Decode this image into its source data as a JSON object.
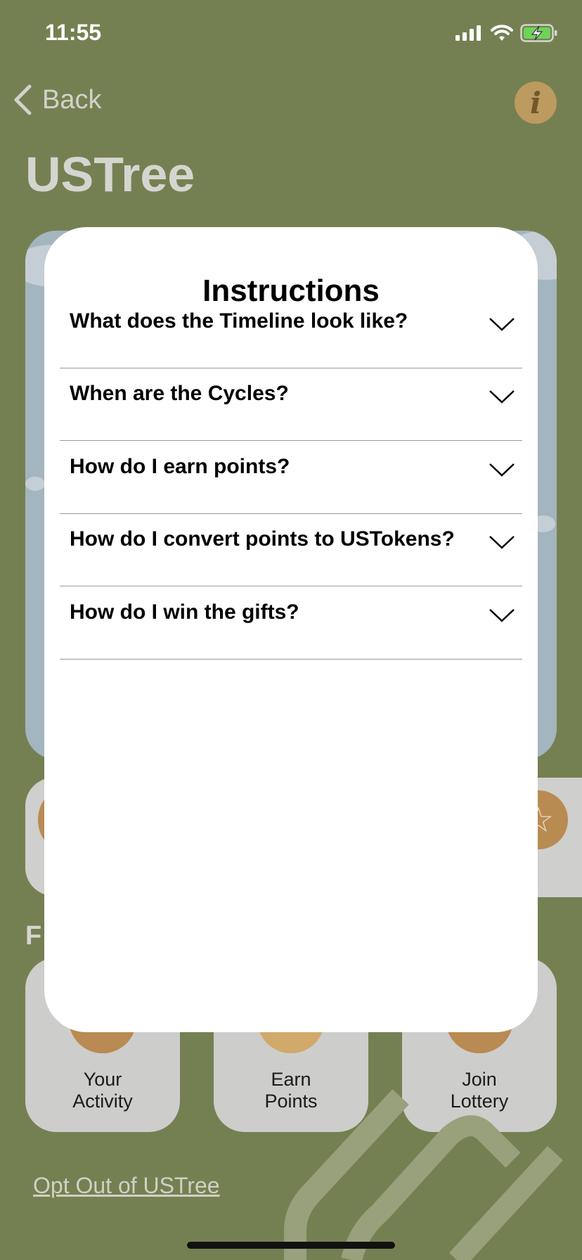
{
  "status_bar": {
    "time": "11:55",
    "icons": [
      "signal-icon",
      "wifi-icon",
      "battery-charging-icon"
    ]
  },
  "header": {
    "back_label": "Back",
    "title": "USTree",
    "info_glyph": "i"
  },
  "background": {
    "section_label": "F",
    "actions": [
      {
        "line1": "Your",
        "line2": "Activity",
        "icon": "activity-icon",
        "color": "#b98a52"
      },
      {
        "line1": "Earn",
        "line2": "Points",
        "icon": "points-icon",
        "color": "#d1a96b"
      },
      {
        "line1": "Join",
        "line2": "Lottery",
        "icon": "lottery-icon",
        "color": "#b98a52"
      }
    ],
    "opt_out_label": "Opt Out of USTree"
  },
  "modal": {
    "title": "Instructions",
    "questions": [
      "What does the Timeline look like?",
      "When are the Cycles?",
      "How do I earn points?",
      "How do I convert points to USTokens?",
      "How do I win the gifts?"
    ]
  },
  "colors": {
    "background": "#758052",
    "accent_gold": "#b98a52",
    "modal": "#ffffff"
  }
}
